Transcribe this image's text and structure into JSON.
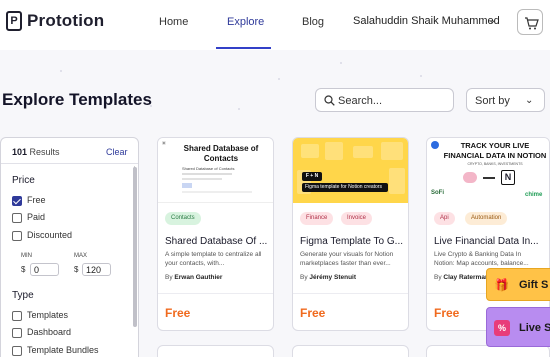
{
  "header": {
    "logo_mark": "P",
    "brand": "Prototion",
    "nav": [
      "Home",
      "Explore",
      "Blog"
    ],
    "user": "Salahuddin Shaik Muhammed"
  },
  "page": {
    "title": "Explore Templates",
    "search_placeholder": "Search...",
    "sort_label": "Sort by"
  },
  "filters": {
    "results_count": "101",
    "results_label": "Results",
    "clear_label": "Clear",
    "price_title": "Price",
    "price_options": [
      {
        "label": "Free",
        "checked": true
      },
      {
        "label": "Paid",
        "checked": false
      },
      {
        "label": "Discounted",
        "checked": false
      }
    ],
    "min_label": "MIN",
    "max_label": "MAX",
    "currency": "$",
    "min_value": "0",
    "max_value": "120",
    "type_title": "Type",
    "type_options": [
      {
        "label": "Templates",
        "checked": false
      },
      {
        "label": "Dashboard",
        "checked": false
      },
      {
        "label": "Template Bundles",
        "checked": false
      }
    ]
  },
  "cards": [
    {
      "thumb_title": "Shared Database of Contacts",
      "thumb_small": "Shared Database of Contacts",
      "tags": [
        "Contacts"
      ],
      "title": "Shared Database Of ...",
      "desc": "A simple template to centralize all your contacts, with...",
      "by": "By",
      "author": "Erwan Gauthier",
      "price": "Free"
    },
    {
      "thumb_badge": "Figma template for Notion creators",
      "thumb_logo": "F + N",
      "tags": [
        "Finance",
        "Invoice"
      ],
      "title": "Figma Template To G...",
      "desc": "Generate your visuals for Notion marketplaces faster than ever...",
      "by": "By",
      "author": "Jérémy Stenuit",
      "price": "Free"
    },
    {
      "thumb_title": "TRACK YOUR LIVE FINANCIAL DATA IN NOTION",
      "thumb_sub": "CRYPTO, BANKS, INVESTMENTS",
      "thumb_left_logo": "SoFi",
      "thumb_right_logo": "chime",
      "thumb_notion": "N",
      "tags": [
        "Api",
        "Automation"
      ],
      "title": "Live Financial Data In...",
      "desc": "Live Crypto & Banking Data In Notion: Map accounts, balance...",
      "by": "By",
      "author": "Clay Raterman",
      "price": "Free"
    }
  ],
  "promos": {
    "gift": "Gift S",
    "live": "Live S"
  },
  "colors": {
    "accent": "#2f3a9a",
    "price": "#f06a1e",
    "gift_bg": "#ffc247",
    "live_bg": "#b88cf0"
  }
}
